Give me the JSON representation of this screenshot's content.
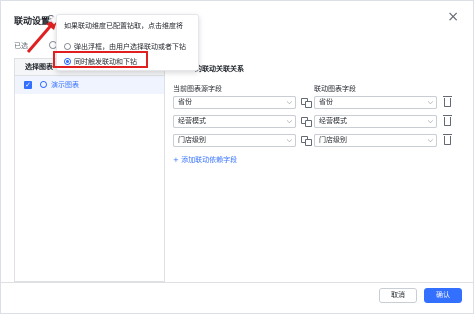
{
  "dialog": {
    "title": "联动设置",
    "close": "×",
    "mode_label": "已选",
    "left_panel": {
      "header": "选择图表",
      "items": [
        {
          "label": "演示图表",
          "checked": true
        }
      ]
    },
    "right_panel": {
      "title": "的联动关联关系",
      "col_source": "当前图表源字段",
      "col_target": "联动图表字段",
      "rows": [
        {
          "source": "省份",
          "target": "省份"
        },
        {
          "source": "经营模式",
          "target": "经营模式"
        },
        {
          "source": "门店级别",
          "target": "门店级别"
        }
      ],
      "add_link": "+ 添加联动依赖字段"
    },
    "footer": {
      "cancel": "取消",
      "ok": "确认"
    }
  },
  "popover": {
    "title": "如果联动维度已配置钻取，点击维度将",
    "options": [
      {
        "label": "弹出浮框，由用户选择联动或者下钻",
        "selected": false
      },
      {
        "label": "同时触发联动和下钻",
        "selected": true
      }
    ]
  },
  "colors": {
    "accent": "#3370ff",
    "annotation": "#e02020"
  }
}
